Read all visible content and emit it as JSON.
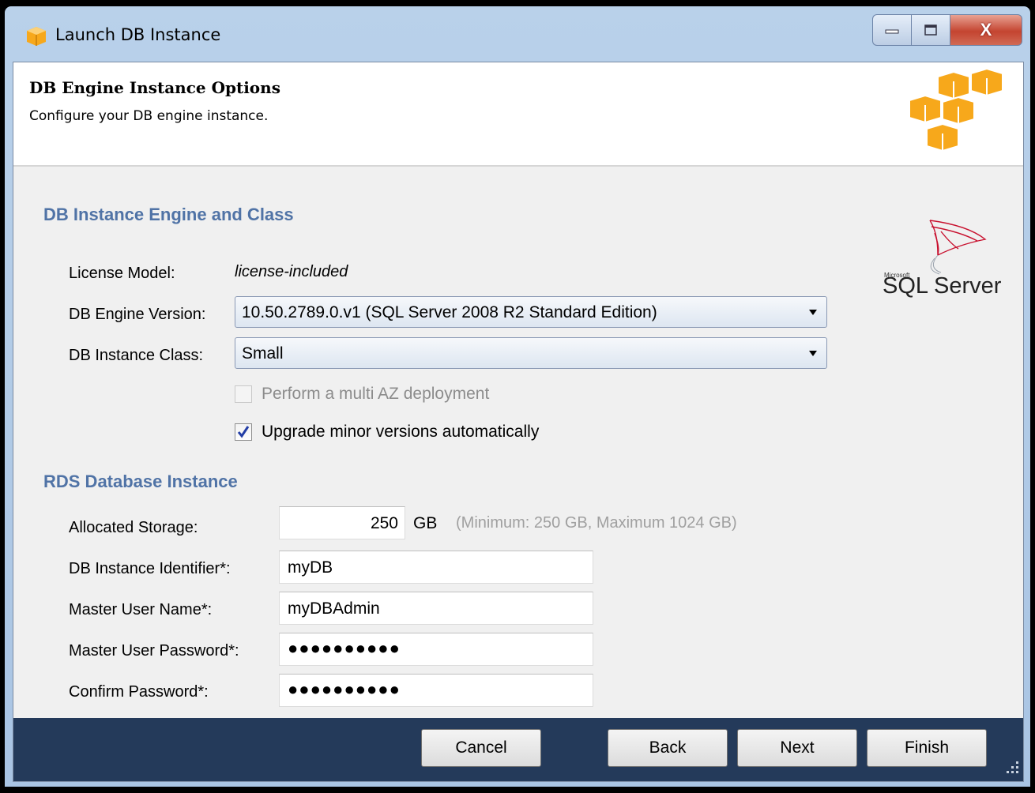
{
  "window": {
    "title": "Launch DB Instance",
    "icon": "aws-cube-icon",
    "controls": [
      "minimize-icon",
      "maximize-icon",
      "close-icon"
    ],
    "close_glyph": "X"
  },
  "header": {
    "title": "DB Engine Instance Options",
    "subtitle": "Configure your DB engine instance.",
    "logo": "aws-cubes-logo"
  },
  "engine_section": {
    "title": "DB Instance Engine and Class",
    "license_model_label": "License Model:",
    "license_model_value": "license-included",
    "engine_version_label": "DB Engine Version:",
    "engine_version_value": "10.50.2789.0.v1 (SQL Server 2008 R2 Standard Edition)",
    "instance_class_label": "DB Instance Class:",
    "instance_class_value": "Small",
    "multi_az_label": "Perform a multi AZ deployment",
    "multi_az_checked": false,
    "multi_az_enabled": false,
    "auto_upgrade_label": "Upgrade minor versions automatically",
    "auto_upgrade_checked": true,
    "logo_small": "Microsoft",
    "logo_text": "SQL Server"
  },
  "rds_section": {
    "title": "RDS Database Instance",
    "allocated_storage_label": "Allocated Storage:",
    "allocated_storage_value": "250",
    "storage_unit": "GB",
    "storage_hint": "(Minimum: 250 GB, Maximum 1024 GB)",
    "identifier_label": "DB Instance Identifier*:",
    "identifier_value": "myDB",
    "master_user_label": "Master User Name*:",
    "master_user_value": "myDBAdmin",
    "password_label": "Master User Password*:",
    "password_value": "●●●●●●●●●●",
    "confirm_label": "Confirm Password*:",
    "confirm_value": "●●●●●●●●●●"
  },
  "footer": {
    "cancel": "Cancel",
    "back": "Back",
    "next": "Next",
    "finish": "Finish"
  },
  "colors": {
    "section_heading": "#5073a6",
    "footer_bg": "#243a5a",
    "aws_orange": "#f7a81b"
  }
}
